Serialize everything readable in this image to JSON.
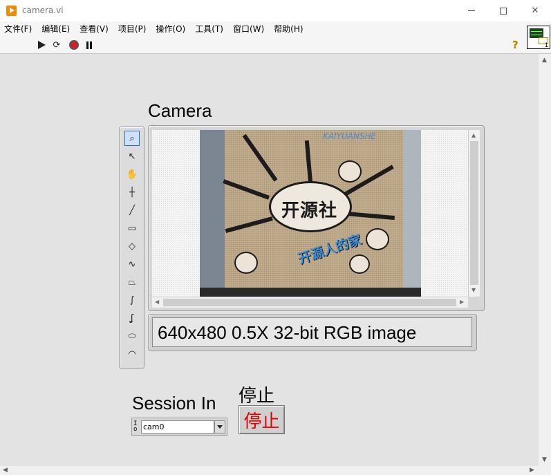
{
  "window": {
    "title": "camera.vi",
    "controls": {
      "minimize_icon": "minimize-icon",
      "maximize_icon": "maximize-icon",
      "close_icon": "close-icon"
    }
  },
  "menu": {
    "items": [
      "文件(F)",
      "编辑(E)",
      "查看(V)",
      "项目(P)",
      "操作(O)",
      "工具(T)",
      "窗口(W)",
      "帮助(H)"
    ]
  },
  "toolbar": {
    "icons": [
      "run-arrow-icon",
      "run-continuously-icon",
      "abort-icon",
      "pause-icon"
    ],
    "help_glyph": "?",
    "vi_icon_number": "1"
  },
  "front_panel": {
    "camera_label": "Camera",
    "image_info": "640x480 0.5X 32-bit RGB image",
    "session_label": "Session In",
    "session_io_glyph": "I\n0",
    "session_value": "cam0",
    "stop_label": "停止",
    "stop_button_text": "停止"
  },
  "palette": {
    "tools": [
      "zoom-icon",
      "pointer-icon",
      "pan-icon",
      "point-icon",
      "line-icon",
      "rectangle-icon",
      "rotated-rectangle-icon",
      "polyline-icon",
      "polygon-icon",
      "freehand-line-icon",
      "freehand-region-icon",
      "oval-icon",
      "annulus-icon"
    ],
    "glyphs": [
      "⌕",
      "↖",
      "✋",
      "┼",
      "╱",
      "▭",
      "◇",
      "∿",
      "⏢",
      "∫",
      "ʆ",
      "⬭",
      "◠"
    ]
  },
  "photo": {
    "logo_text": "开源社",
    "blue_text": "开源人的家",
    "top_text": "KAIYUANSHE"
  },
  "colors": {
    "panel_bg": "#e3e3e3",
    "stop_text": "#e00000",
    "accent_blue": "#3f8fd6"
  }
}
